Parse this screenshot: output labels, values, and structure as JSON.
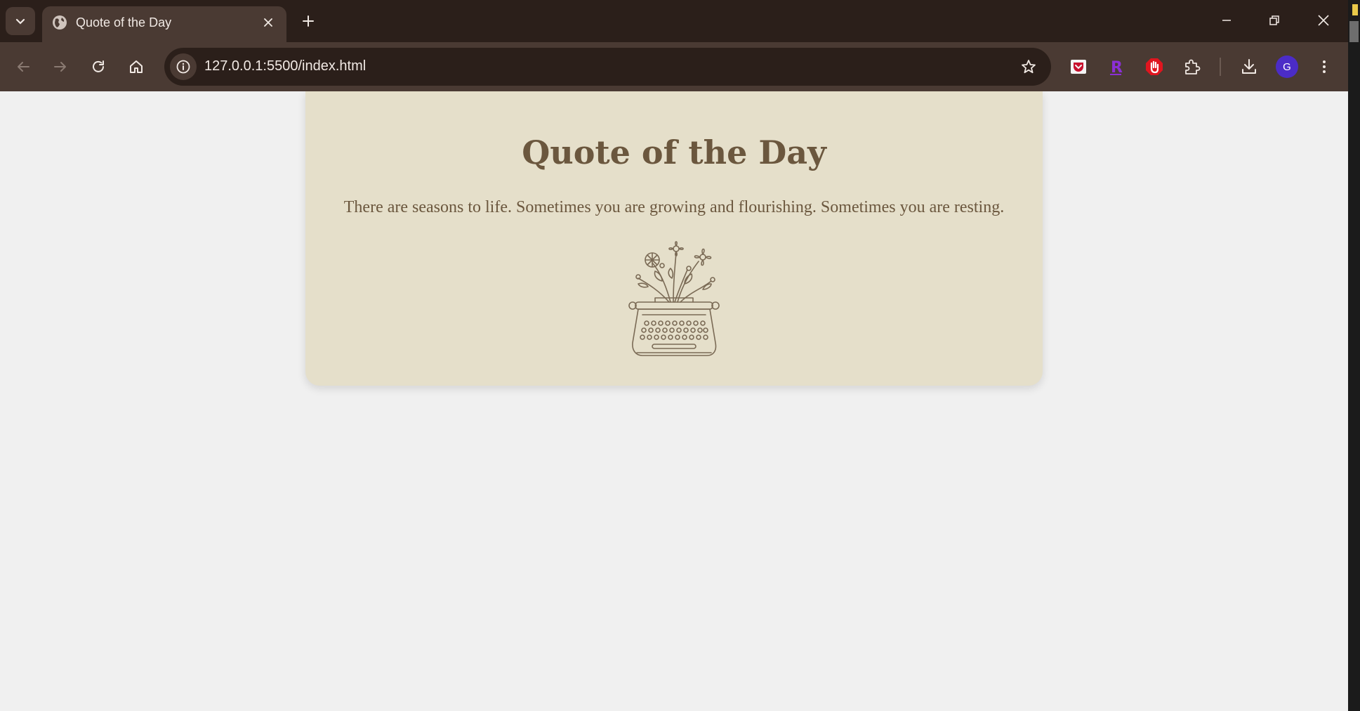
{
  "browser": {
    "tab": {
      "title": "Quote of the Day",
      "favicon": "globe-icon"
    },
    "address_bar": {
      "url": "127.0.0.1:5500/index.html"
    },
    "toolbar_icons": [
      "back-icon",
      "forward-icon",
      "reload-icon",
      "home-icon",
      "site-info-icon",
      "bookmark-star-icon"
    ],
    "extensions": [
      "pocket-icon",
      "r-extension-icon",
      "stop-hand-icon",
      "extensions-puzzle-icon"
    ],
    "profile": {
      "initial": "G",
      "color": "#4b2cc7"
    }
  },
  "page": {
    "title": "Quote of the Day",
    "quote": "There are seasons to life. Sometimes you are growing and flourishing. Sometimes you are resting.",
    "illustration": "typewriter-with-flowers-illustration",
    "colors": {
      "background": "#f0f0f0",
      "card": "#e5dfca",
      "text": "#6b573e"
    }
  }
}
